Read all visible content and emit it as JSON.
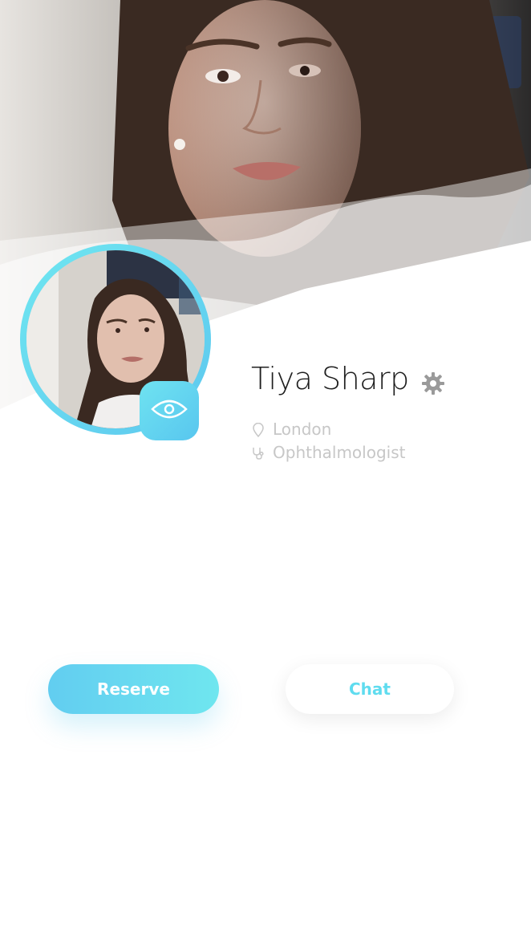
{
  "profile": {
    "name": "Tiya Sharp",
    "location": "London",
    "profession": "Ophthalmologist"
  },
  "actions": {
    "reserve_label": "Reserve",
    "chat_label": "Chat"
  },
  "icons": {
    "view": "eye-icon",
    "settings": "gear-icon",
    "location": "pin-icon",
    "profession": "stethoscope-icon"
  },
  "colors": {
    "accent_start": "#62cdf0",
    "accent_end": "#6fe6ef",
    "name_text": "#1f1f1f",
    "meta_text": "#c7c7c7"
  }
}
